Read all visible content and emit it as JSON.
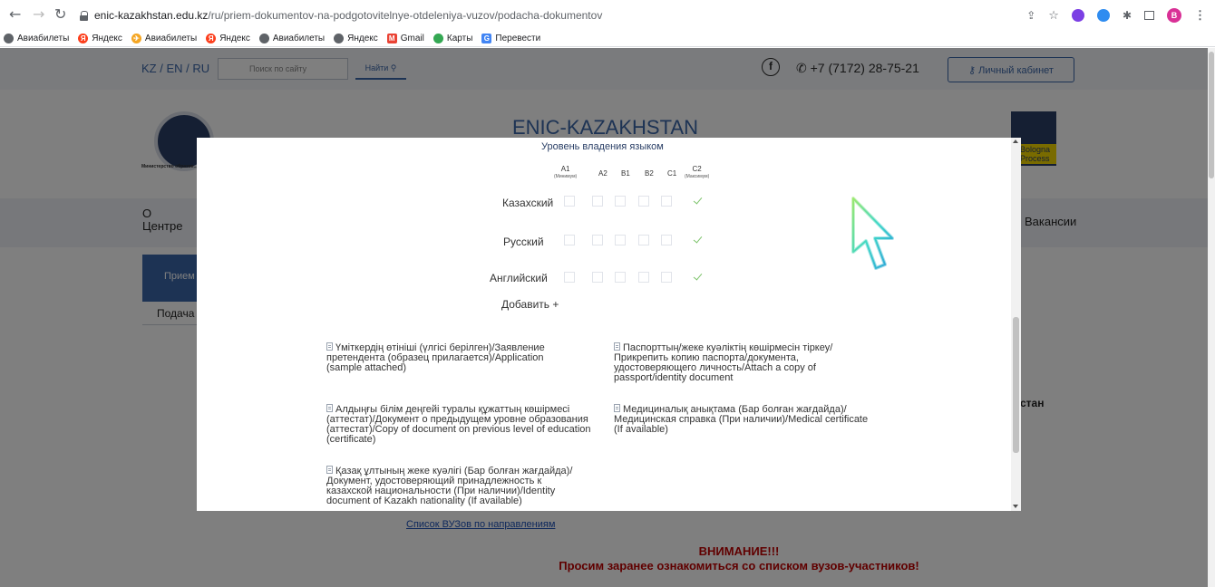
{
  "browser": {
    "url_host": "enic-kazakhstan.edu.kz",
    "url_path": "/ru/priem-dokumentov-na-podgotovitelnye-otdeleniya-vuzov/podacha-dokumentov",
    "profile_initial": "B",
    "bookmarks": [
      {
        "label": "Авиабилеты",
        "icon": "globe-icon",
        "color": "#5f6368"
      },
      {
        "label": "Яндекс",
        "icon": "yandex-icon",
        "color": "#fc3f1d"
      },
      {
        "label": "Авиабилеты",
        "icon": "plane-icon",
        "color": "#f5a623"
      },
      {
        "label": "Яндекс",
        "icon": "yandex-icon",
        "color": "#fc3f1d"
      },
      {
        "label": "Авиабилеты",
        "icon": "globe-icon",
        "color": "#5f6368"
      },
      {
        "label": "Яндекс",
        "icon": "globe-icon",
        "color": "#5f6368"
      },
      {
        "label": "Gmail",
        "icon": "gmail-icon",
        "color": "#ea4335"
      },
      {
        "label": "Карты",
        "icon": "maps-icon",
        "color": "#34a853"
      },
      {
        "label": "Перевести",
        "icon": "translate-icon",
        "color": "#4285f4"
      }
    ]
  },
  "site": {
    "lang_switch": "KZ / EN / RU",
    "search_placeholder": "Поиск по сайту",
    "search_button": "Найти",
    "facebook_glyph": "f",
    "phone": "+7 (7172) 28-75-21",
    "cabinet": "Личный кабинет",
    "title": "ENIC-KAZAKHSTAN",
    "logo_caption": "Министерство образов... Республики Каз...",
    "bologna_label": "Bologna Process",
    "menu_about_1": "О",
    "menu_about_2": "Центре",
    "menu_jobs": "Вакансии",
    "tab_active": "Прием",
    "sub_item": "Подача д",
    "right_fragment": "стан",
    "vuz_link": "Список ВУЗов по направлениям",
    "attention_1": "ВНИМАНИЕ!!!",
    "attention_2": "Просим заранее ознакомиться со списком вузов-участников!"
  },
  "modal": {
    "section_title": "Уровень владения языком",
    "levels": [
      {
        "code": "A1",
        "note": "(Минимум)"
      },
      {
        "code": "A2",
        "note": ""
      },
      {
        "code": "B1",
        "note": ""
      },
      {
        "code": "B2",
        "note": ""
      },
      {
        "code": "C1",
        "note": ""
      },
      {
        "code": "C2",
        "note": "(Максимум)"
      }
    ],
    "languages": [
      {
        "label": "Казахский",
        "level": "C2"
      },
      {
        "label": "Русский",
        "level": "C2"
      },
      {
        "label": "Английский",
        "level": "C2"
      }
    ],
    "add_button": "Добавить +",
    "documents": [
      "Үміткердің өтініші (үлгісі берілген)/Заявление претендента (образец прилагается)/Application (sample attached)",
      "Паспорттың/жеке куәліктің көшірмесін тіркеу/ Прикрепить копию паспорта/документа, удостоверяющего личность/Attach a copy of passport/identity document",
      "Алдыңғы білім деңгейі туралы құжаттың көшірмесі (аттестат)/Документ о предыдущем уровне образования (аттестат)/Copy of document on previous level of education (certificate)",
      "Медициналық анықтама (Бар болған жағдайда)/ Медицинская справка (При наличии)/Medical certificate (If available)",
      "Қазақ ұлтының жеке куәлігі (Бар болған жағдайда)/ Документ, удостоверяющий принадлежность к казахской национальности (При наличии)/Identity document of Kazakh nationality (If available)"
    ]
  }
}
